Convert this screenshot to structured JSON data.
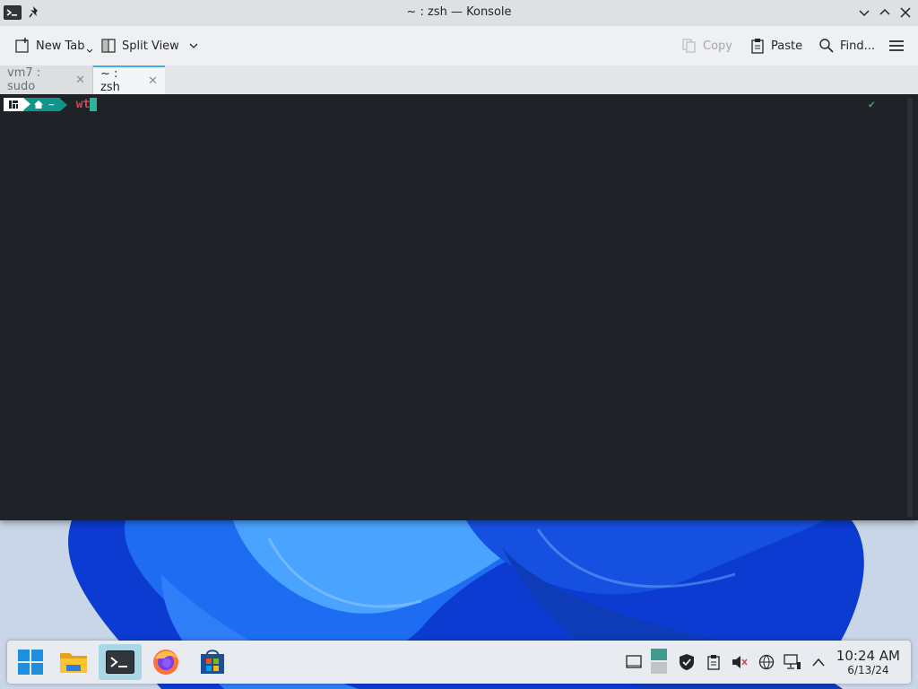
{
  "window": {
    "title": "~ : zsh — Konsole"
  },
  "toolbar": {
    "new_tab_label": "New Tab",
    "split_view_label": "Split View",
    "copy_label": "Copy",
    "paste_label": "Paste",
    "find_label": "Find..."
  },
  "tabs": [
    {
      "label": "vm7 : sudo",
      "active": false
    },
    {
      "label": "~ : zsh",
      "active": true
    }
  ],
  "terminal": {
    "prompt_dir": "~",
    "typed_command": "wt",
    "status_icon": "✔"
  },
  "taskbar": {
    "apps": [
      {
        "name": "start-menu-icon",
        "active": false
      },
      {
        "name": "file-manager-icon",
        "active": false
      },
      {
        "name": "konsole-icon",
        "active": true
      },
      {
        "name": "firefox-icon",
        "active": false
      },
      {
        "name": "store-icon",
        "active": false
      }
    ],
    "clock_time": "10:24 AM",
    "clock_date": "6/13/24"
  },
  "colors": {
    "accent": "#3daee9",
    "prompt_teal": "#10958a",
    "command_red": "#e0424a",
    "terminal_bg": "#1f2226"
  }
}
